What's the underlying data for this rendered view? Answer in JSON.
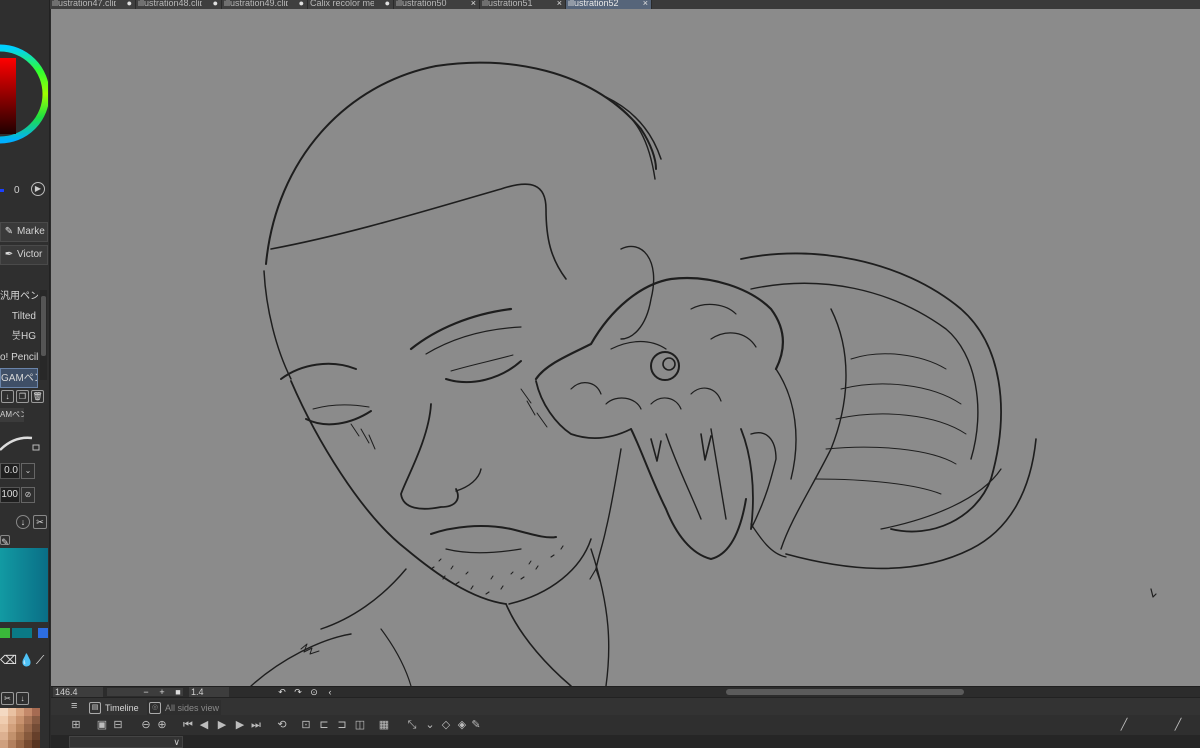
{
  "tabs": [
    {
      "label": "illustration47.clip",
      "active": false
    },
    {
      "label": "illustration48.clip",
      "active": false
    },
    {
      "label": "illustration49.clip",
      "active": false
    },
    {
      "label": "Calix recolor me",
      "active": false
    },
    {
      "label": "illustration50",
      "active": false
    },
    {
      "label": "illustration51",
      "active": false
    },
    {
      "label": "illustration52",
      "active": true
    }
  ],
  "tab_close_glyph": "×",
  "tab_modified_glyph": "●",
  "color": {
    "slider_value": "0",
    "accent": "#ff0000"
  },
  "tools": [
    {
      "label": "Marke",
      "icon": "marker-icon"
    },
    {
      "label": "Victor",
      "icon": "pen-icon"
    }
  ],
  "brush_list": {
    "header": "汎用ペン+",
    "items": [
      {
        "label": "Tilted",
        "selected": false
      },
      {
        "label": "붓HG",
        "selected": false
      },
      {
        "label": "o! Pencil",
        "selected": false
      },
      {
        "label": "GAMペン",
        "selected": true
      }
    ]
  },
  "brush_tab": "AMペン",
  "brush_size": "0.0",
  "brush_opacity": "100",
  "timeline": {
    "tabs": [
      {
        "label": "Timeline",
        "active": true
      },
      {
        "label": "All sides view",
        "active": false
      }
    ],
    "dropdown_value": "∨"
  },
  "status": {
    "zoom": "146.4",
    "rotation": "1.4",
    "minus": "−",
    "plus": "+"
  },
  "canvas": {
    "background": "#8b8b8b",
    "line_color": "#1e1e1e"
  }
}
